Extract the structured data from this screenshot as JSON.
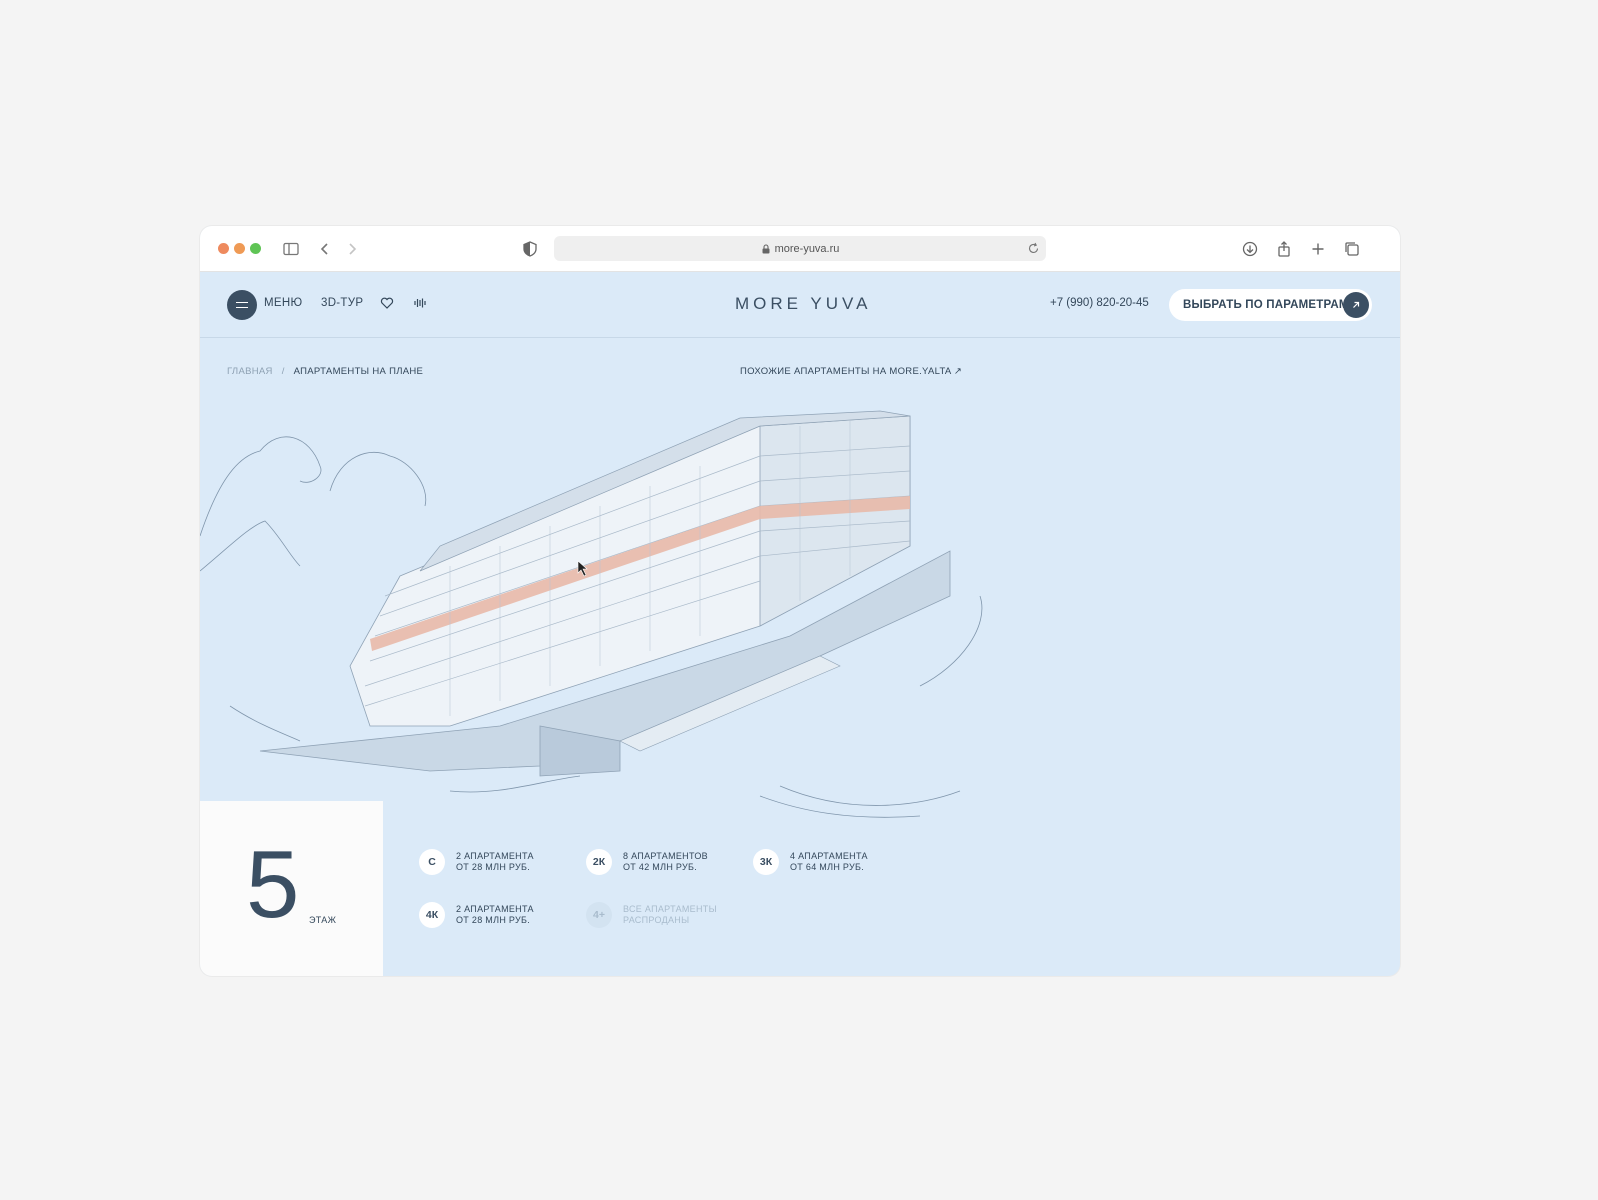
{
  "browser": {
    "url": "more-yuva.ru"
  },
  "header": {
    "menu_label": "МЕНЮ",
    "tour_label": "3D-ТУР",
    "logo": "MORE YUVA",
    "phone": "+7 (990) 820-20-45",
    "cta_label": "ВЫБРАТЬ ПО ПАРАМЕТРАМ"
  },
  "breadcrumb": {
    "home": "ГЛАВНАЯ",
    "separator": "/",
    "current": "АПАРТАМЕНТЫ НА ПЛАНЕ"
  },
  "similar_link": "ПОХОЖИЕ АПАРТАМЕНТЫ НА MORE.YALTA ↗",
  "floor": {
    "number": "5",
    "label": "ЭТАЖ"
  },
  "apartment_types": [
    {
      "badge": "С",
      "line1": "2 АПАРТАМЕНТА",
      "line2": "ОТ 28 МЛН РУБ.",
      "sold_out": false
    },
    {
      "badge": "2К",
      "line1": "8 АПАРТАМЕНТОВ",
      "line2": "ОТ 42 МЛН РУБ.",
      "sold_out": false
    },
    {
      "badge": "3К",
      "line1": "4 АПАРТАМЕНТА",
      "line2": "ОТ 64 МЛН РУБ.",
      "sold_out": false
    },
    {
      "badge": "4К",
      "line1": "2 АПАРТАМЕНТА",
      "line2": "ОТ 28 МЛН РУБ.",
      "sold_out": false
    },
    {
      "badge": "4+",
      "line1": "ВСЕ АПАРТАМЕНТЫ",
      "line2": "РАСПРОДАНЫ",
      "sold_out": true
    }
  ],
  "colors": {
    "page_bg": "#dbeaf8",
    "accent_dark": "#3b4f63",
    "highlight_floor": "#e8b9a8"
  }
}
